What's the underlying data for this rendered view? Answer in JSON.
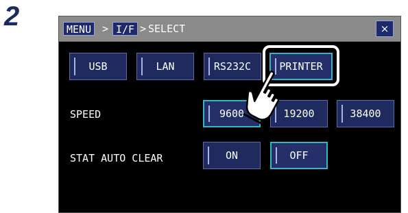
{
  "step_number": "2",
  "titlebar": {
    "breadcrumb_menu": "MENU",
    "sep1": ">",
    "breadcrumb_if": "I/F",
    "sep2": ">",
    "breadcrumb_select": "SELECT",
    "close_label": "×"
  },
  "interface_buttons": [
    "USB",
    "LAN",
    "RS232C",
    "PRINTER"
  ],
  "speed": {
    "label": "SPEED",
    "options": [
      "9600",
      "19200",
      "38400"
    ],
    "selected": "9600"
  },
  "stat_auto_clear": {
    "label": "STAT AUTO CLEAR",
    "options": [
      "ON",
      "OFF"
    ],
    "selected": "OFF"
  },
  "colors": {
    "button_bg": "#1f2b5e",
    "selected_border": "#31b7c8",
    "titlebar": "#8a8a8a",
    "screen_bg": "#000000"
  },
  "icons": {
    "hand": "pointing-hand-icon",
    "close": "close-icon"
  }
}
